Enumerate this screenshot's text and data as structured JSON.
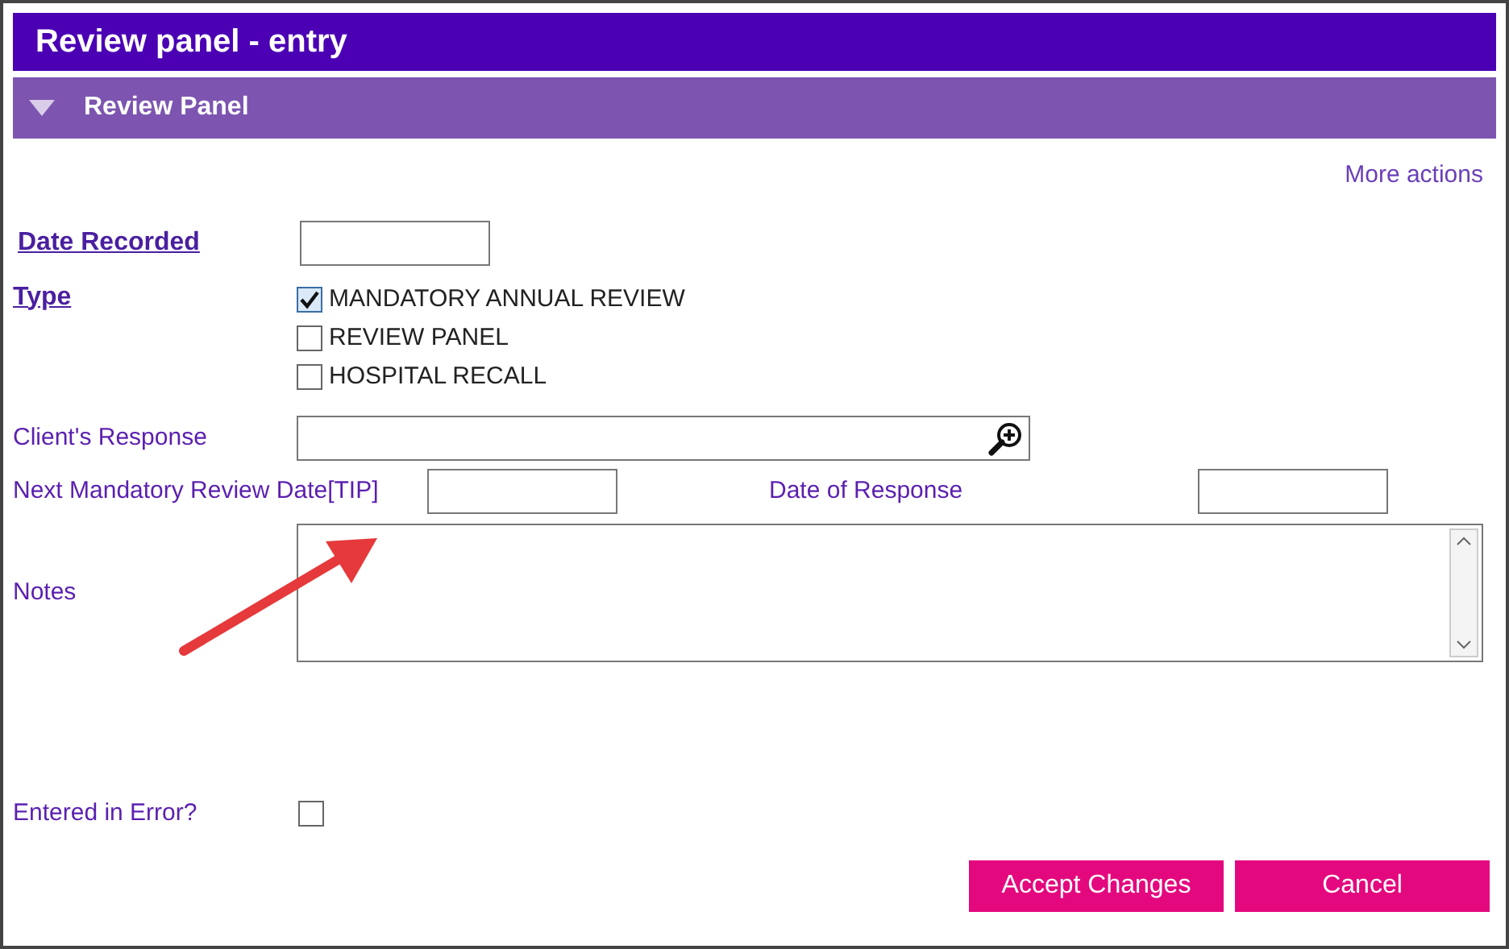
{
  "window": {
    "title": "Review panel - entry"
  },
  "section": {
    "title": "Review Panel",
    "expanded": true
  },
  "more_actions": "More actions",
  "date_recorded": {
    "label": "Date Recorded"
  },
  "type": {
    "label": "Type",
    "options": [
      {
        "label": "MANDATORY ANNUAL REVIEW",
        "checked": true
      },
      {
        "label": "REVIEW PANEL",
        "checked": false
      },
      {
        "label": "HOSPITAL RECALL",
        "checked": false
      }
    ]
  },
  "clients_response": {
    "label": "Client's Response"
  },
  "next_review": {
    "label": "Next Mandatory Review Date[TIP]"
  },
  "date_of_response": {
    "label": "Date of Response"
  },
  "notes": {
    "label": "Notes"
  },
  "entered_in_error": {
    "label": "Entered in Error?",
    "checked": false
  },
  "buttons": [
    "Accept Changes",
    "Cancel"
  ],
  "annotation": {
    "kind": "arrow"
  }
}
